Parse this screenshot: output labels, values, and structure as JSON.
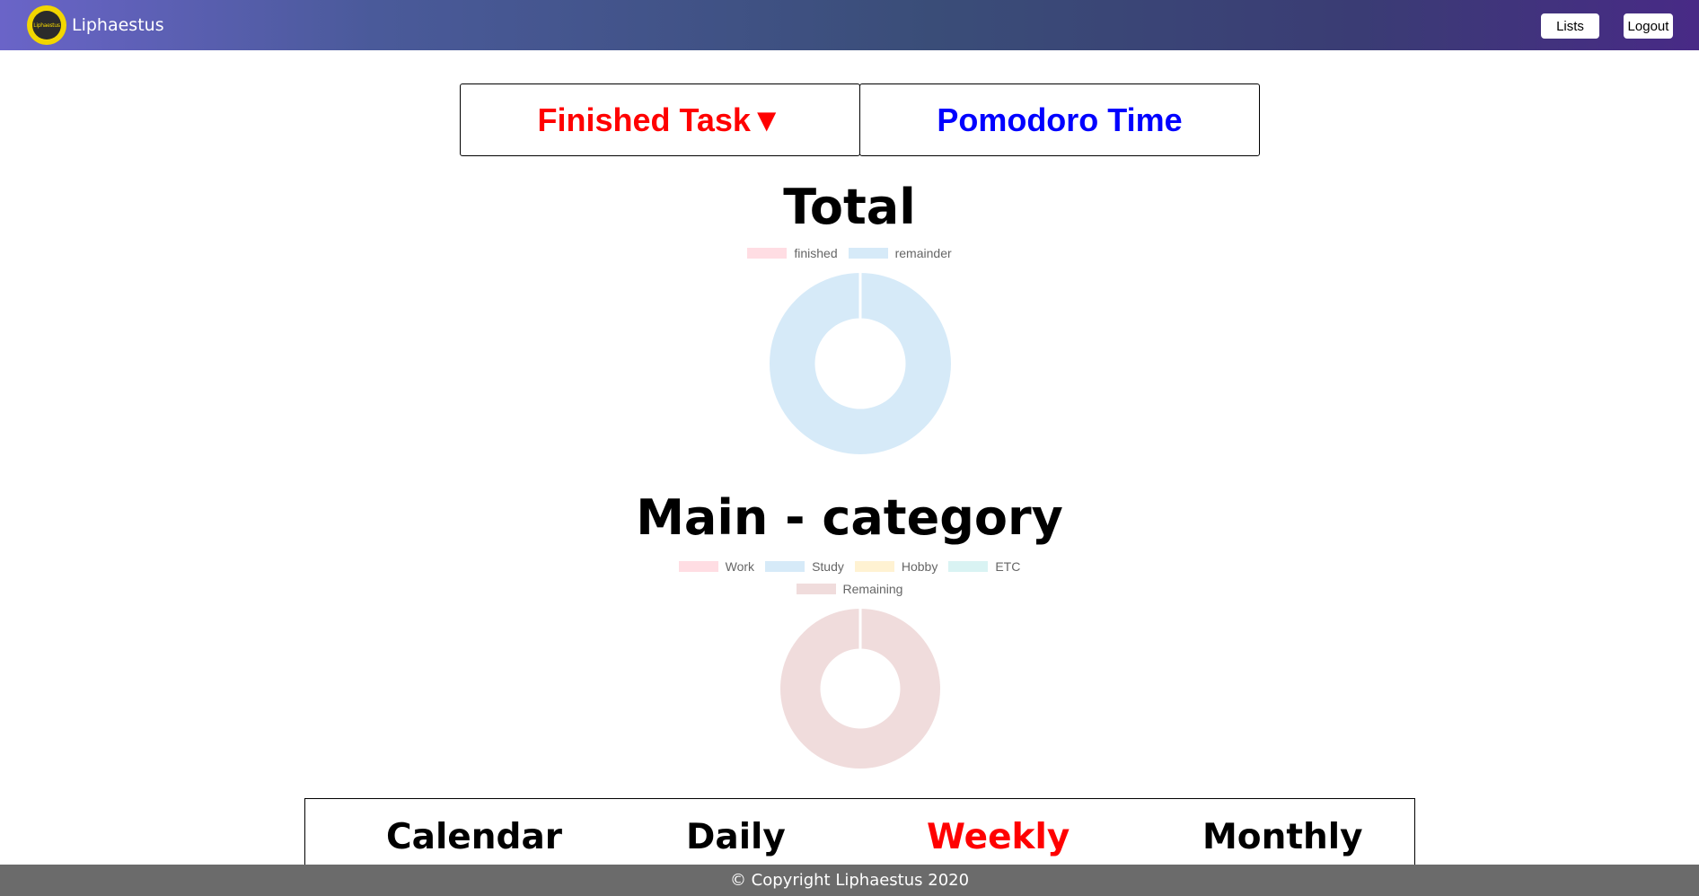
{
  "header": {
    "logo_text": "Liphaestus",
    "brand": "Liphaestus",
    "lists_label": "Lists",
    "logout_label": "Logout"
  },
  "toggle": {
    "finished_task_label": "Finished Task▼",
    "pomodoro_label": "Pomodoro Time",
    "active_color": "#ff0000",
    "inactive_color": "#0000ff"
  },
  "sections": {
    "total_title": "Total",
    "main_title": "Main - category"
  },
  "chart_data": [
    {
      "type": "pie",
      "title": "Total",
      "legend": [
        "finished",
        "remainder"
      ],
      "colors": [
        "#ffdde3",
        "#d6eaf8"
      ],
      "values": [
        0,
        1
      ]
    },
    {
      "type": "pie",
      "title": "Main - category",
      "legend": [
        "Work",
        "Study",
        "Hobby",
        "ETC",
        "Remaining"
      ],
      "colors": [
        "#ffdde3",
        "#d6eaf8",
        "#fff2d2",
        "#d9f3f3",
        "#f0dcdc"
      ],
      "values": [
        0,
        0,
        0,
        0,
        1
      ]
    }
  ],
  "period_nav": {
    "calendar": "Calendar",
    "daily": "Daily",
    "weekly": "Weekly",
    "monthly": "Monthly",
    "selected": "Weekly"
  },
  "footer": {
    "text": "© Copyright Liphaestus 2020"
  }
}
